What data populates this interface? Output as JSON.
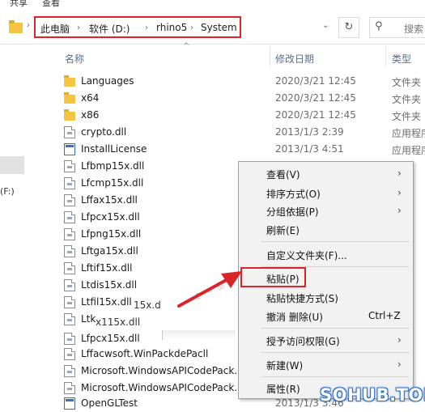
{
  "ribbon": {
    "tab_share": "共享",
    "tab_view": "查看"
  },
  "address": {
    "crumbs": [
      "此电脑",
      "软件 (D:)",
      "rhino5",
      "System"
    ],
    "search_placeholder": "搜索",
    "refresh_glyph": "↻",
    "search_glyph": "⚲"
  },
  "nav": {
    "drive_label": "(F:)"
  },
  "columns": {
    "name": "名称",
    "date": "修改日期",
    "type": "类型"
  },
  "files": [
    {
      "name": "Languages",
      "date": "2020/3/21 12:45",
      "type": "文件夹",
      "icon": "folder"
    },
    {
      "name": "x64",
      "date": "2020/3/21 12:45",
      "type": "文件夹",
      "icon": "folder"
    },
    {
      "name": "x86",
      "date": "2020/3/21 12:45",
      "type": "文件夹",
      "icon": "folder"
    },
    {
      "name": "crypto.dll",
      "date": "2013/1/3 2:39",
      "type": "应用程序",
      "icon": "dll"
    },
    {
      "name": "InstallLicense",
      "date": "2013/1/3 4:51",
      "type": "应用程序",
      "icon": "exe"
    },
    {
      "name": "Lfbmp15x.dll",
      "date": "",
      "type": "",
      "icon": "dll"
    },
    {
      "name": "Lfcmp15x.dll",
      "date": "",
      "type": "",
      "icon": "dll"
    },
    {
      "name": "Lffax15x.dll",
      "date": "",
      "type": "",
      "icon": "dll"
    },
    {
      "name": "Lfpcx15x.dll",
      "date": "",
      "type": "",
      "icon": "dll"
    },
    {
      "name": "Lfpng15x.dll",
      "date": "",
      "type": "",
      "icon": "dll"
    },
    {
      "name": "Lftga15x.dll",
      "date": "",
      "type": "",
      "icon": "dll"
    },
    {
      "name": "Lftif15x.dll",
      "date": "",
      "type": "",
      "icon": "dll"
    },
    {
      "name": "Ltdis15x.dll",
      "date": "",
      "type": "",
      "icon": "dll"
    },
    {
      "name": "Ltfil15x.dll",
      "date": "",
      "type": "",
      "icon": "dll"
    },
    {
      "name": "Ltk",
      "date": "",
      "type": "",
      "icon": "dll"
    },
    {
      "name": "Lfpcx15x.dll",
      "date": "",
      "type": "",
      "icon": "dll"
    },
    {
      "name": "Lffacwsoft.WinPackdePacll",
      "date": "",
      "type": "",
      "icon": "dll"
    },
    {
      "name": "Microsoft.WindowsAPICodePack.",
      "date": "",
      "type": "",
      "icon": "dll"
    },
    {
      "name": "Microsoft.WindowsAPICodePack.S",
      "date": "",
      "type": "",
      "icon": "dll"
    },
    {
      "name": "OpenGLTest",
      "date": "2013/1/3 3:46",
      "type": "",
      "icon": "exe"
    }
  ],
  "ghost_texts": [
    "15x.d",
    "x115x.dll"
  ],
  "context_menu": {
    "items": [
      {
        "label": "查看(V)",
        "arrow": "›",
        "shortcut": ""
      },
      {
        "label": "排序方式(O)",
        "arrow": "›",
        "shortcut": ""
      },
      {
        "label": "分组依据(P)",
        "arrow": "›",
        "shortcut": ""
      },
      {
        "label": "刷新(E)",
        "arrow": "",
        "shortcut": ""
      },
      {
        "label": "自定义文件夹(F)...",
        "arrow": "",
        "shortcut": ""
      },
      {
        "label": "粘贴(P)",
        "arrow": "",
        "shortcut": ""
      },
      {
        "label": "粘贴快捷方式(S)",
        "arrow": "",
        "shortcut": ""
      },
      {
        "label": "撤消 删除(U)",
        "arrow": "",
        "shortcut": "Ctrl+Z"
      },
      {
        "label": "授予访问权限(G)",
        "arrow": "›",
        "shortcut": ""
      },
      {
        "label": "新建(W)",
        "arrow": "›",
        "shortcut": ""
      },
      {
        "label": "属性(R)",
        "arrow": "",
        "shortcut": ""
      }
    ]
  },
  "watermark": "SOHUB.TOP",
  "colors": {
    "highlight_red": "#d9252a",
    "folder_yellow": "#f4c542",
    "menu_bg": "#f2f2f2"
  }
}
